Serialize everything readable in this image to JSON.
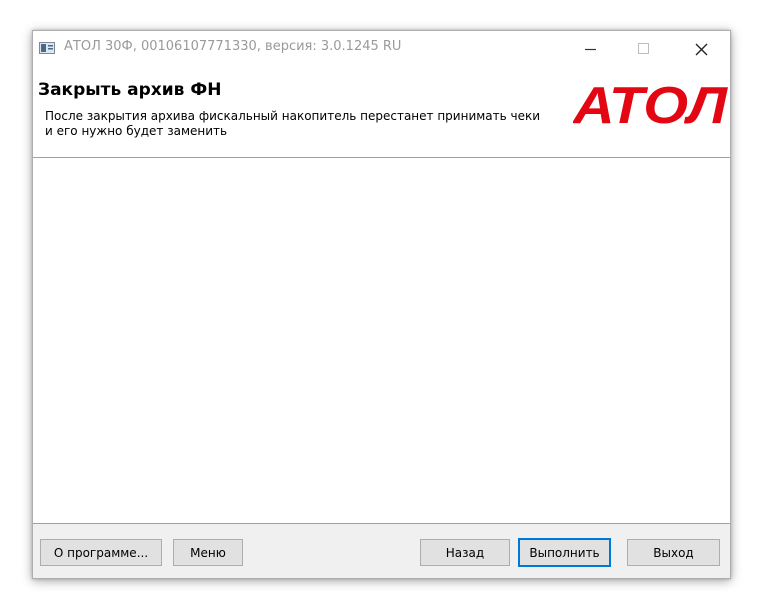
{
  "window": {
    "title": "АТОЛ 30Ф, 00106107771330, версия: 3.0.1245 RU",
    "minimize_icon": "minimize-icon",
    "maximize_icon": "maximize-icon",
    "close_icon": "close-icon"
  },
  "header": {
    "title": "Закрыть архив ФН",
    "description": "После закрытия архива фискальный накопитель перестанет принимать чеки и его нужно будет заменить",
    "logo_text": "АТОЛ",
    "logo_color": "#e30613"
  },
  "buttons": {
    "about": "О программе...",
    "menu": "Меню",
    "back": "Назад",
    "execute": "Выполнить",
    "exit": "Выход"
  },
  "colors": {
    "accent": "#0078d7",
    "title_text": "#9a9a9a"
  }
}
